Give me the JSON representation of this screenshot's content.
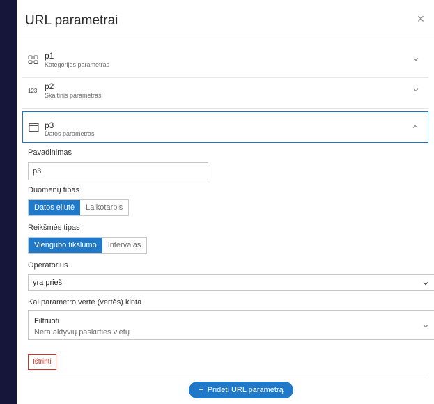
{
  "header": {
    "title": "URL parametrai",
    "close_glyph": "×",
    "close_icon": "close-icon"
  },
  "params": [
    {
      "name": "p1",
      "desc": "Kategorijos parametras",
      "icon": "category-icon",
      "expanded": false
    },
    {
      "name": "p2",
      "desc": "Skaitinis parametras",
      "icon": "number-icon",
      "icon_text": "123",
      "expanded": false
    },
    {
      "name": "p3",
      "desc": "Datos parametras",
      "icon": "calendar-icon",
      "expanded": true
    }
  ],
  "form": {
    "name_label": "Pavadinimas",
    "name_value": "p3",
    "datatype_label": "Duomenų tipas",
    "datatype_options": [
      "Datos eilutė",
      "Laikotarpis"
    ],
    "datatype_selected": "Datos eilutė",
    "valuetype_label": "Reikšmės tipas",
    "valuetype_options": [
      "Viengubo tikslumo",
      "Intervalas"
    ],
    "valuetype_selected": "Viengubo tikslumo",
    "operator_label": "Operatorius",
    "operator_value": "yra prieš",
    "change_label": "Kai parametro vertė (vertės) kinta",
    "change_title": "Filtruoti",
    "change_sub": "Nėra aktyvių paskirties vietų",
    "delete_label": "Ištrinti"
  },
  "footer": {
    "add_label": "Pridėti URL parametrą",
    "add_glyph": "+"
  },
  "colors": {
    "accent": "#1f79c8",
    "danger": "#d83020",
    "background": "#15163a"
  }
}
